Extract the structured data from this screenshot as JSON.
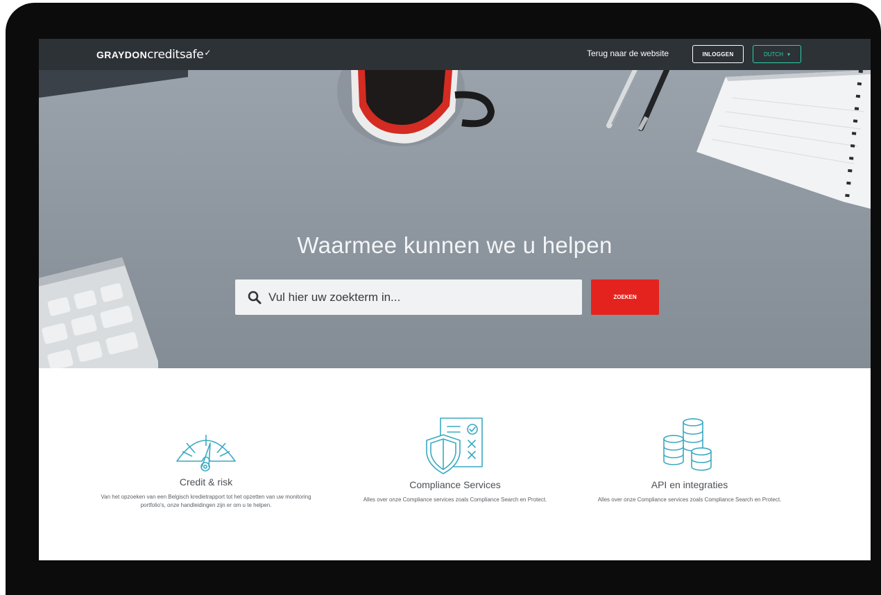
{
  "header": {
    "logo_bold": "GRAYDON",
    "logo_light": "creditsafe",
    "back_link": "Terug naar de website",
    "login_label": "INLOGGEN",
    "language_label": "DUTCH"
  },
  "hero": {
    "title": "Waarmee kunnen we u helpen",
    "search_placeholder": "Vul hier uw zoekterm in...",
    "search_button": "ZOEKEN"
  },
  "cards": [
    {
      "icon": "speedometer-icon",
      "title": "Credit & risk",
      "description": "Van het opzoeken van een Belgisch kredietrapport tot het opzetten van uw monitoring portfolio's, onze handleidingen zijn er om u te helpen."
    },
    {
      "icon": "shield-checklist-icon",
      "title": "Compliance Services",
      "description": "Alles over onze Compliance services zoals Compliance Search en Protect."
    },
    {
      "icon": "database-stack-icon",
      "title": "API en integraties",
      "description": "Alles over onze Compliance services zoals Compliance Search en Protect."
    }
  ],
  "colors": {
    "nav_bg": "#2d3237",
    "accent_green": "#2bd0a8",
    "search_red": "#e5231e",
    "icon_teal": "#3aa9c2"
  }
}
